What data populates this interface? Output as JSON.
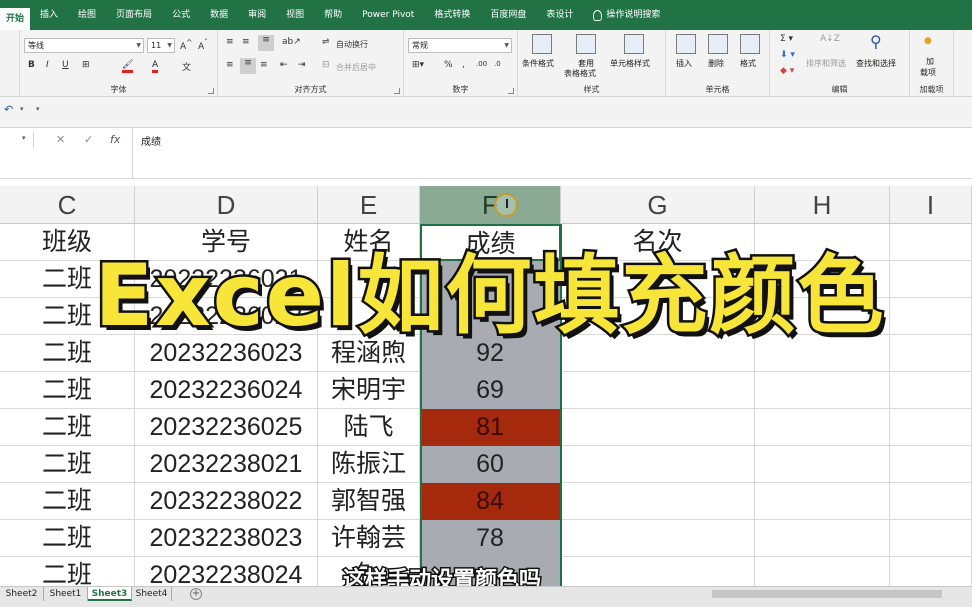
{
  "ribbon_tabs": [
    {
      "label": "开始",
      "active": true
    },
    {
      "label": "插入"
    },
    {
      "label": "绘图"
    },
    {
      "label": "页面布局"
    },
    {
      "label": "公式"
    },
    {
      "label": "数据"
    },
    {
      "label": "审阅"
    },
    {
      "label": "视图"
    },
    {
      "label": "帮助"
    },
    {
      "label": "Power Pivot"
    },
    {
      "label": "格式转换"
    },
    {
      "label": "百度网盘"
    },
    {
      "label": "表设计"
    },
    {
      "label": "操作说明搜索"
    }
  ],
  "ribbon": {
    "font": {
      "name": "等线",
      "size": "11",
      "group_label": "字体"
    },
    "alignment": {
      "wrap": "自动换行",
      "merge": "合并后居中",
      "group_label": "对齐方式"
    },
    "number": {
      "format": "常规",
      "group_label": "数字"
    },
    "styles": {
      "conditional": "条件格式",
      "table1": "套用",
      "table2": "表格格式",
      "cell_style": "单元格样式",
      "group_label": "样式"
    },
    "cells": {
      "insert": "插入",
      "delete": "删除",
      "format": "格式",
      "group_label": "单元格"
    },
    "editing": {
      "sort": "排序和筛选",
      "find": "查找和选择",
      "group_label": "编辑"
    },
    "addins": {
      "load1": "加",
      "load2": "载项",
      "group_label": "加载项"
    }
  },
  "formula_bar": {
    "value": "成绩",
    "fx": "fx"
  },
  "columns": [
    "C",
    "D",
    "E",
    "F",
    "G",
    "H",
    "I"
  ],
  "table": {
    "headers": [
      "班级",
      "学号",
      "姓名",
      "成绩",
      "名次"
    ],
    "rows": [
      {
        "class": "二班",
        "id": "20232236021",
        "name": "",
        "score": ""
      },
      {
        "class": "二班",
        "id": "20232236022",
        "name": "",
        "score": ""
      },
      {
        "class": "二班",
        "id": "20232236023",
        "name": "程涵煦",
        "score": "92"
      },
      {
        "class": "二班",
        "id": "20232236024",
        "name": "宋明宇",
        "score": "69"
      },
      {
        "class": "二班",
        "id": "20232236025",
        "name": "陆飞",
        "score": "81",
        "highlight": true
      },
      {
        "class": "二班",
        "id": "20232238021",
        "name": "陈振江",
        "score": "60"
      },
      {
        "class": "二班",
        "id": "20232238022",
        "name": "郭智强",
        "score": "84",
        "highlight": true
      },
      {
        "class": "二班",
        "id": "20232238023",
        "name": "许翰芸",
        "score": "78"
      },
      {
        "class": "二班",
        "id": "20232238024",
        "name": "钅",
        "score": ""
      }
    ]
  },
  "overlay_title": "Excel如何填充颜色",
  "subtitle": "这样手动设置颜色吗",
  "sheet_tabs": [
    {
      "label": "Sheet2"
    },
    {
      "label": "Sheet1"
    },
    {
      "label": "Sheet3",
      "active": true
    },
    {
      "label": "Sheet4"
    }
  ],
  "colors": {
    "excel_green": "#217346",
    "highlight_fill": "#a52a0d",
    "selection_fill": "#a8abb2",
    "title_yellow": "#f7e53a"
  }
}
